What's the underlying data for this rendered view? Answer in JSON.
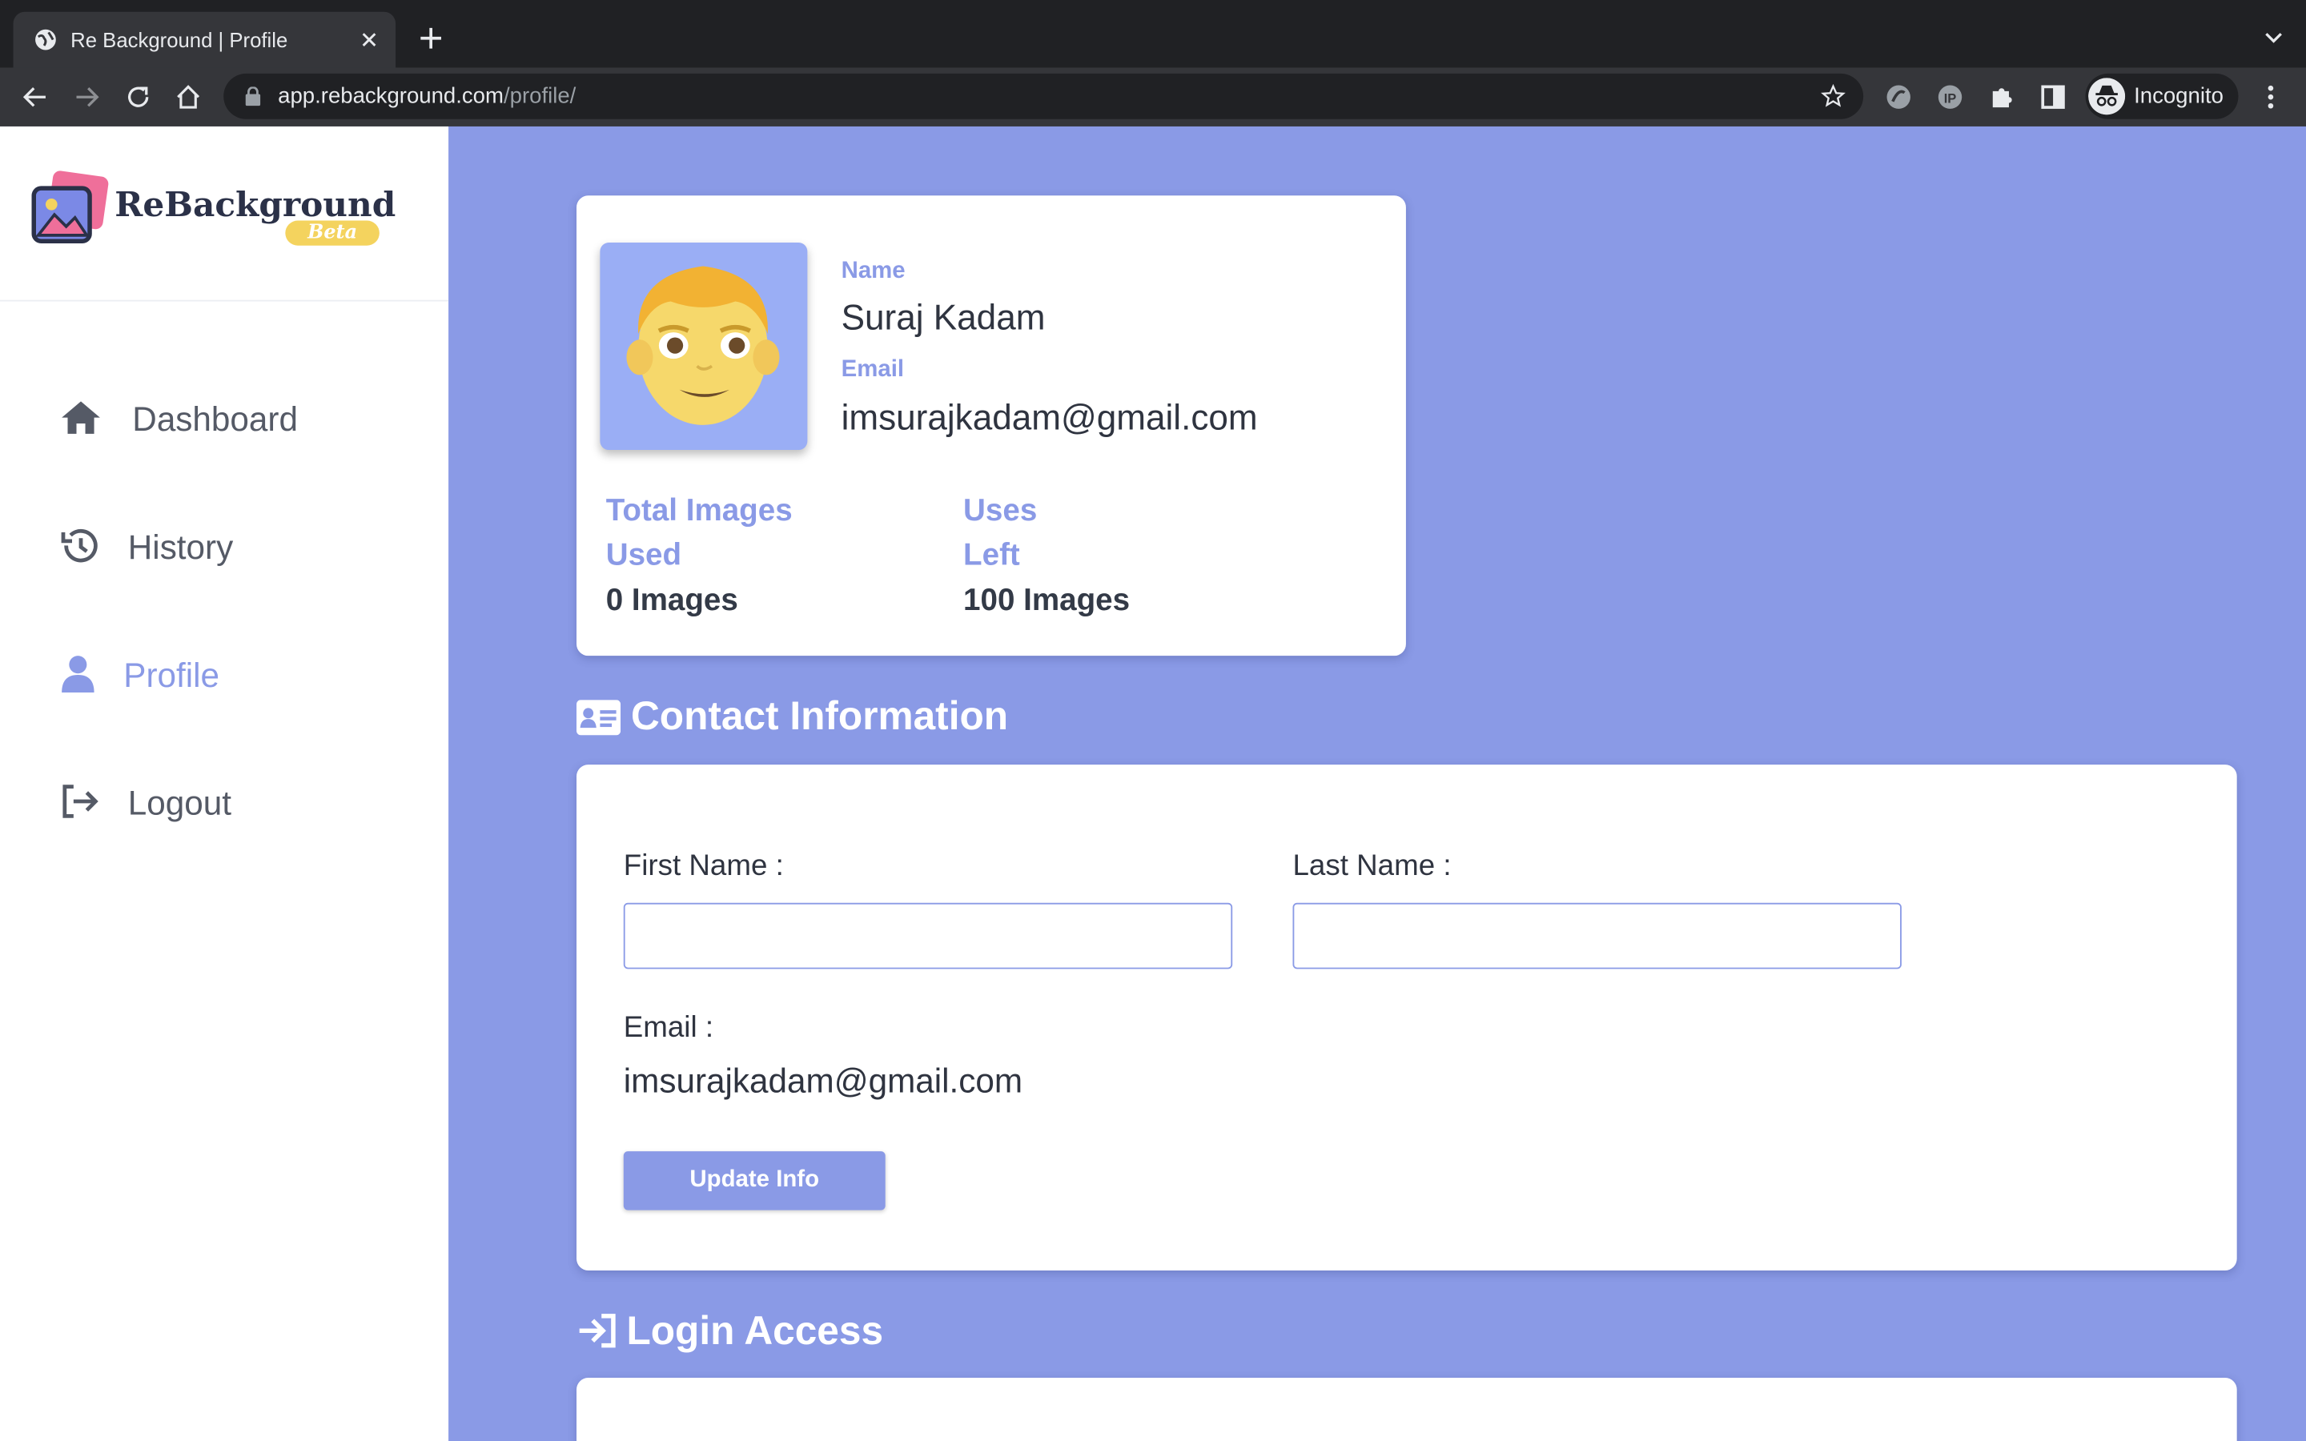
{
  "browser": {
    "tab_title": "Re Background | Profile",
    "url_host": "app.rebackground.com",
    "url_path": "/profile/",
    "incognito_label": "Incognito"
  },
  "sidebar": {
    "logo_text": "ReBackground",
    "logo_badge": "Beta",
    "items": [
      {
        "label": "Dashboard",
        "icon": "home-icon"
      },
      {
        "label": "History",
        "icon": "history-icon"
      },
      {
        "label": "Profile",
        "icon": "user-icon",
        "active": true
      },
      {
        "label": "Logout",
        "icon": "logout-icon"
      }
    ]
  },
  "profile": {
    "name_label": "Name",
    "name": "Suraj Kadam",
    "email_label": "Email",
    "email": "imsurajkadam@gmail.com",
    "total_label_1": "Total Images",
    "total_label_2": "Used",
    "total_value": "0 Images",
    "left_label_1": "Uses",
    "left_label_2": "Left",
    "left_value": "100 Images"
  },
  "contact": {
    "title": "Contact Information",
    "first_name_label": "First Name :",
    "first_name_value": "",
    "last_name_label": "Last Name :",
    "last_name_value": "",
    "email_label": "Email :",
    "email_value": "imsurajkadam@gmail.com",
    "update_button": "Update Info"
  },
  "login": {
    "title": "Login Access"
  },
  "colors": {
    "accent": "#8a9ae6",
    "sidebar_bg": "#ffffff",
    "chrome_dark": "#202124"
  }
}
